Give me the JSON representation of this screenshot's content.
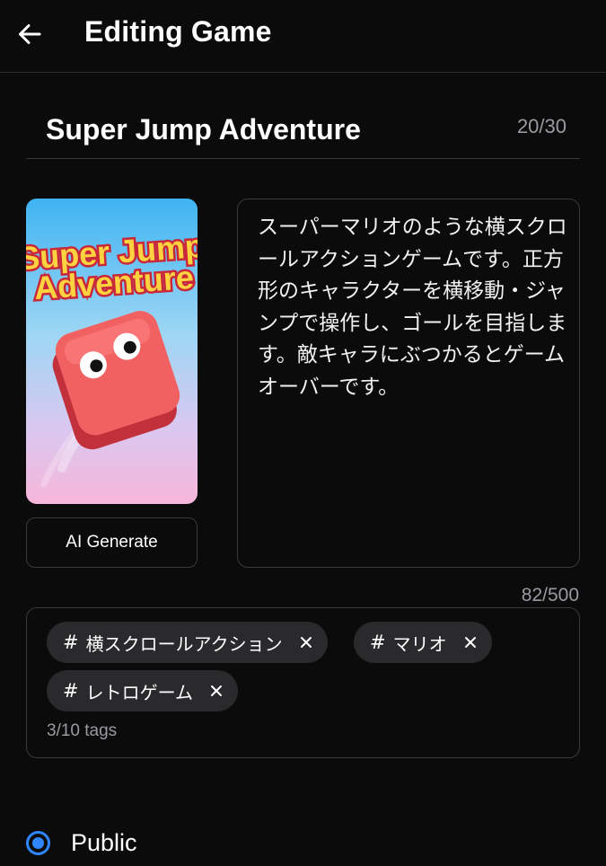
{
  "header": {
    "title": "Editing Game",
    "back_icon": "arrow-left-icon"
  },
  "game_title": {
    "value": "Super Jump Adventure",
    "counter": "20/30"
  },
  "thumbnail": {
    "text_line1": "Super Jump",
    "text_line2": "Adventure",
    "colors": {
      "title_fill": "#ffd23f",
      "title_outline": "#c8283a",
      "character": "#f26161",
      "character_side": "#c2303c"
    }
  },
  "ai_generate": {
    "label": "AI Generate"
  },
  "description": {
    "value": "スーパーマリオのような横スクロールアクションゲームです。正方形のキャラクターを横移動・ジャンプで操作し、ゴールを目指します。敵キャラにぶつかるとゲームオーバーです。",
    "counter": "82/500"
  },
  "tags": {
    "items": [
      {
        "hash": "#",
        "label": "横スクロールアクション",
        "remove_icon": "close-icon"
      },
      {
        "hash": "#",
        "label": "マリオ",
        "remove_icon": "close-icon"
      },
      {
        "hash": "#",
        "label": "レトロゲーム",
        "remove_icon": "close-icon"
      }
    ],
    "count": "3/10 tags"
  },
  "visibility": {
    "selected_label": "Public",
    "accent": "#2f86ff"
  }
}
